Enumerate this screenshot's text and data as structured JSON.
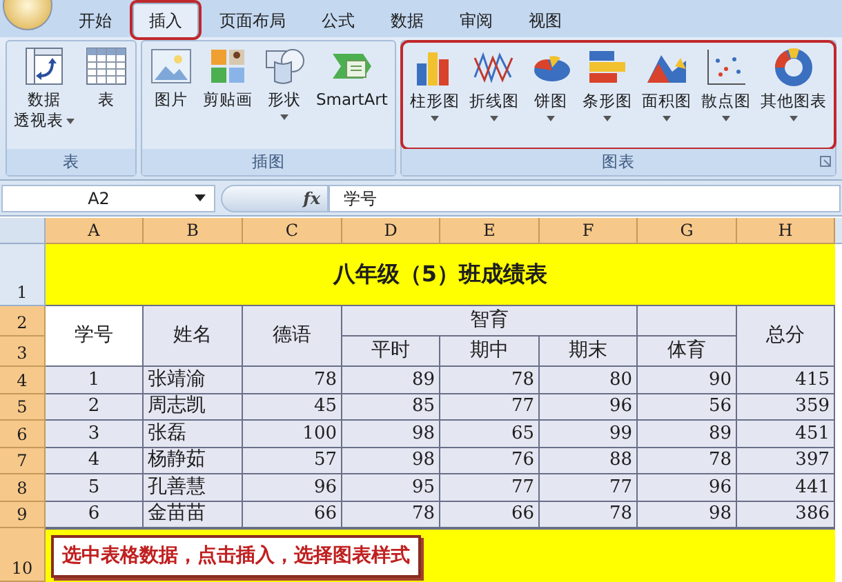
{
  "tabs": [
    {
      "label": "开始",
      "selected": false,
      "highlighted": false
    },
    {
      "label": "插入",
      "selected": true,
      "highlighted": true
    },
    {
      "label": "页面布局",
      "selected": false,
      "highlighted": false
    },
    {
      "label": "公式",
      "selected": false,
      "highlighted": false
    },
    {
      "label": "数据",
      "selected": false,
      "highlighted": false
    },
    {
      "label": "审阅",
      "selected": false,
      "highlighted": false
    },
    {
      "label": "视图",
      "selected": false,
      "highlighted": false
    }
  ],
  "ribbon_groups": [
    {
      "label": "表",
      "highlighted": false,
      "items": [
        {
          "kind": "pivot",
          "label": "数据",
          "label2": "透视表",
          "dropdown": true
        },
        {
          "kind": "table",
          "label": "表",
          "dropdown": false
        }
      ]
    },
    {
      "label": "插图",
      "highlighted": false,
      "items": [
        {
          "kind": "picture",
          "label": "图片",
          "dropdown": false
        },
        {
          "kind": "clipart",
          "label": "剪贴画",
          "dropdown": false
        },
        {
          "kind": "shapes",
          "label": "形状",
          "dropdown": true
        },
        {
          "kind": "smartart",
          "label": "SmartArt",
          "dropdown": false
        }
      ]
    },
    {
      "label": "图表",
      "highlighted": true,
      "launcher": true,
      "items": [
        {
          "kind": "column",
          "label": "柱形图",
          "dropdown": true
        },
        {
          "kind": "line",
          "label": "折线图",
          "dropdown": true
        },
        {
          "kind": "pie",
          "label": "饼图",
          "dropdown": true
        },
        {
          "kind": "bar",
          "label": "条形图",
          "dropdown": true
        },
        {
          "kind": "area",
          "label": "面积图",
          "dropdown": true
        },
        {
          "kind": "scatter",
          "label": "散点图",
          "dropdown": true
        },
        {
          "kind": "other",
          "label": "其他图表",
          "dropdown": true
        }
      ]
    }
  ],
  "formula_bar": {
    "name_box": "A2",
    "fx": "fx",
    "value": "学号"
  },
  "sheet": {
    "column_headers": [
      {
        "label": "A",
        "selected": true
      },
      {
        "label": "B",
        "selected": true
      },
      {
        "label": "C",
        "selected": true
      },
      {
        "label": "D",
        "selected": true
      },
      {
        "label": "E",
        "selected": true
      },
      {
        "label": "F",
        "selected": true
      },
      {
        "label": "G",
        "selected": true
      },
      {
        "label": "H",
        "selected": true
      }
    ],
    "row_headers": [
      {
        "label": "1",
        "selected": false
      },
      {
        "label": "2",
        "selected": true
      },
      {
        "label": "3",
        "selected": true
      },
      {
        "label": "4",
        "selected": true
      },
      {
        "label": "5",
        "selected": true
      },
      {
        "label": "6",
        "selected": true
      },
      {
        "label": "7",
        "selected": true
      },
      {
        "label": "8",
        "selected": true
      },
      {
        "label": "9",
        "selected": true
      },
      {
        "label": "10",
        "selected": true
      }
    ],
    "title": "八年级（5）班成绩表",
    "header_cells": [
      {
        "text": "学号",
        "selected": true
      },
      {
        "text": "姓名",
        "selected": false
      },
      {
        "text": "德语",
        "selected": false
      },
      {
        "text": "智育",
        "selected": false
      },
      {
        "text": "平时",
        "selected": false
      },
      {
        "text": "期中",
        "selected": false
      },
      {
        "text": "期末",
        "selected": false
      },
      {
        "text": "体育",
        "selected": false
      },
      {
        "text": "总分",
        "selected": false
      }
    ],
    "rows": [
      [
        "1",
        "张靖渝",
        "78",
        "89",
        "78",
        "80",
        "90",
        "415"
      ],
      [
        "2",
        "周志凯",
        "45",
        "85",
        "77",
        "96",
        "56",
        "359"
      ],
      [
        "3",
        "张磊",
        "100",
        "98",
        "65",
        "99",
        "89",
        "451"
      ],
      [
        "4",
        "杨静茹",
        "57",
        "98",
        "76",
        "88",
        "78",
        "397"
      ],
      [
        "5",
        "孔善慧",
        "96",
        "95",
        "77",
        "77",
        "96",
        "441"
      ],
      [
        "6",
        "金苗苗",
        "66",
        "78",
        "66",
        "78",
        "98",
        "386"
      ]
    ]
  },
  "callout": "选中表格数据，点击插入，选择图表样式"
}
